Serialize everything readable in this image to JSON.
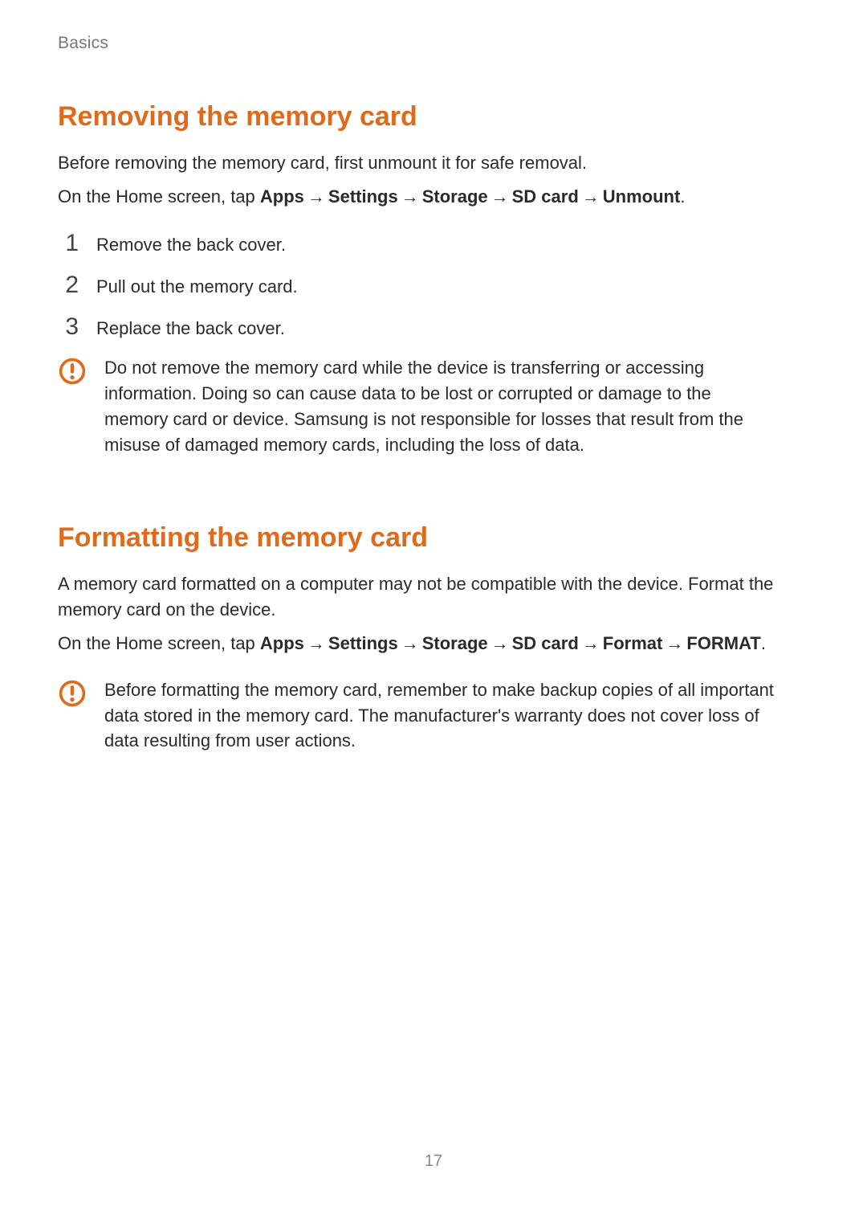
{
  "breadcrumb": "Basics",
  "arrow": "→",
  "section1": {
    "title": "Removing the memory card",
    "intro": "Before removing the memory card, first unmount it for safe removal.",
    "pathPrefix": "On the Home screen, tap ",
    "pathParts": [
      "Apps",
      "Settings",
      "Storage",
      "SD card",
      "Unmount"
    ],
    "pathSuffix": ".",
    "steps": [
      "Remove the back cover.",
      "Pull out the memory card.",
      "Replace the back cover."
    ],
    "warning": "Do not remove the memory card while the device is transferring or accessing information. Doing so can cause data to be lost or corrupted or damage to the memory card or device. Samsung is not responsible for losses that result from the misuse of damaged memory cards, including the loss of data."
  },
  "section2": {
    "title": "Formatting the memory card",
    "intro": "A memory card formatted on a computer may not be compatible with the device. Format the memory card on the device.",
    "pathPrefix": "On the Home screen, tap ",
    "pathParts": [
      "Apps",
      "Settings",
      "Storage",
      "SD card",
      "Format",
      "FORMAT"
    ],
    "pathSuffix": ".",
    "warning": "Before formatting the memory card, remember to make backup copies of all important data stored in the memory card. The manufacturer's warranty does not cover loss of data resulting from user actions."
  },
  "pageNumber": "17"
}
